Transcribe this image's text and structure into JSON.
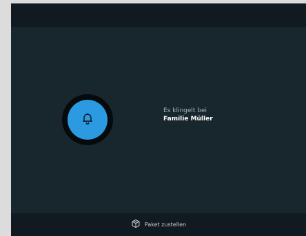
{
  "ring": {
    "line1": "Es klingelt bei",
    "line2": "Familie Müller"
  },
  "footer": {
    "action_label": "Paket zustellen"
  },
  "icons": {
    "bell": "bell-icon",
    "package": "package-icon"
  },
  "colors": {
    "background": "#18262d",
    "bars": "#111a20",
    "accent": "#2b9ae0"
  }
}
